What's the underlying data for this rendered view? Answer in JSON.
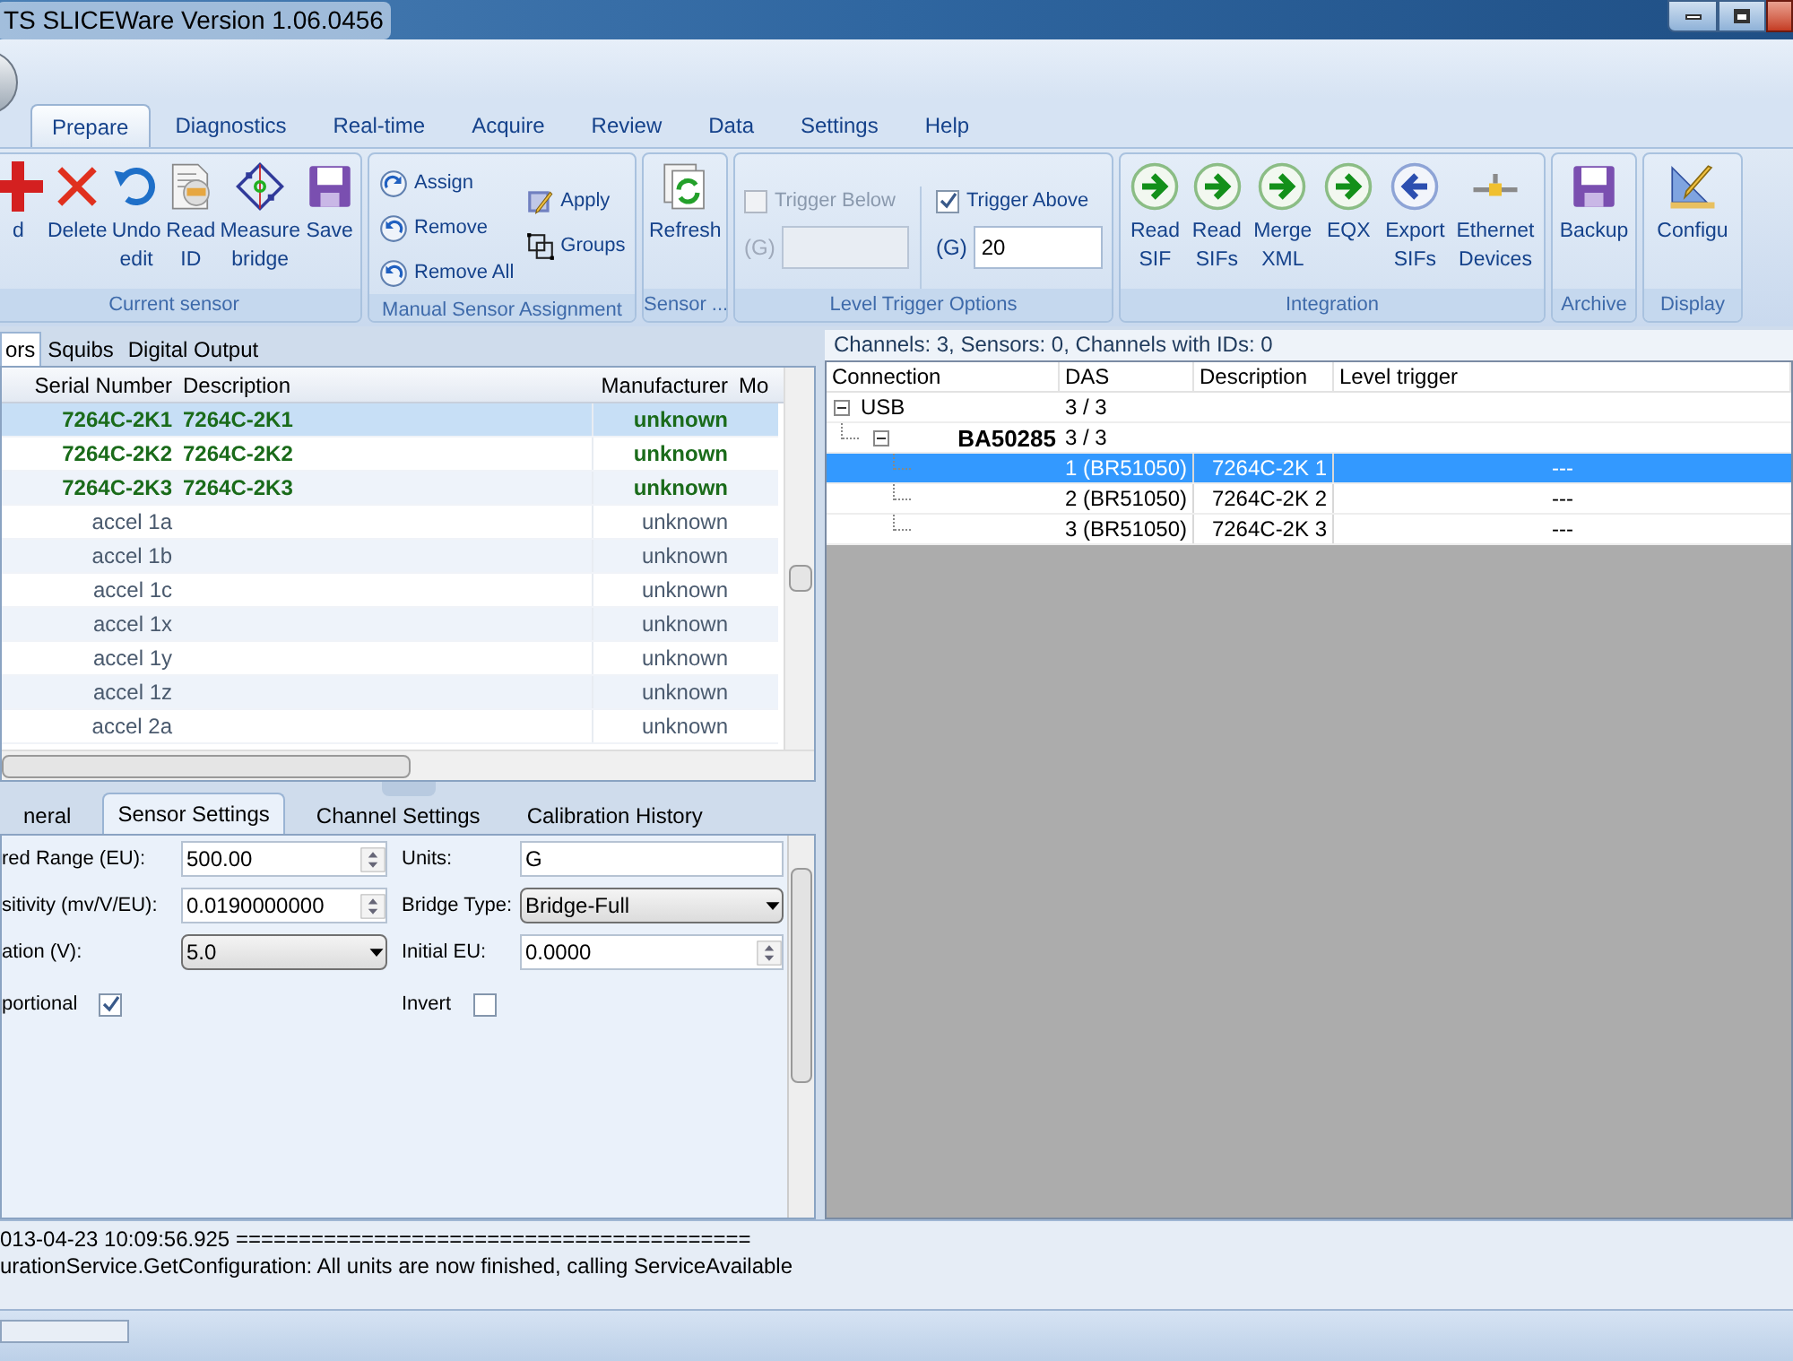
{
  "window": {
    "title": "TS SLICEWare Version 1.06.0456"
  },
  "menu_tabs": [
    {
      "label": "Prepare",
      "selected": true
    },
    {
      "label": "Diagnostics",
      "selected": false
    },
    {
      "label": "Real-time",
      "selected": false
    },
    {
      "label": "Acquire",
      "selected": false
    },
    {
      "label": "Review",
      "selected": false
    },
    {
      "label": "Data",
      "selected": false
    },
    {
      "label": "Settings",
      "selected": false
    },
    {
      "label": "Help",
      "selected": false
    }
  ],
  "ribbon": {
    "groups": [
      {
        "label": "Current sensor",
        "kind": "large",
        "buttons": [
          "d",
          "Delete",
          "Undo\nedit",
          "Read\nID",
          "Measure\nbridge",
          "Save"
        ]
      },
      {
        "label": "Manual Sensor Assignment",
        "kind": "small",
        "buttons": [
          "Assign",
          "Remove",
          "Remove All",
          "Apply",
          "Groups"
        ]
      },
      {
        "label": "Sensor ...",
        "kind": "large",
        "buttons": [
          "Refresh"
        ]
      },
      {
        "label": "Level Trigger Options",
        "kind": "triggers",
        "triggers": [
          {
            "label": "Trigger Below",
            "checked": false,
            "disabled": true,
            "unit": "(G)"
          },
          {
            "label": "Trigger Above",
            "checked": true,
            "disabled": false,
            "unit": "(G)",
            "value": "20"
          }
        ]
      },
      {
        "label": "Integration",
        "kind": "large",
        "buttons": [
          "Read\nSIF",
          "Read\nSIFs",
          "Merge\nXML",
          "EQX",
          "Export\nSIFs",
          "Ethernet\nDevices"
        ]
      },
      {
        "label": "Archive",
        "kind": "large",
        "buttons": [
          "Backup"
        ]
      },
      {
        "label": "Display",
        "kind": "large",
        "buttons": [
          "Configu"
        ]
      }
    ]
  },
  "sensor_tabs": [
    {
      "label": "ors",
      "selected": true
    },
    {
      "label": "Squibs",
      "selected": false
    },
    {
      "label": "Digital Output",
      "selected": false
    }
  ],
  "sensor_table": {
    "columns": [
      "Serial Number",
      "Description",
      "Manufacturer",
      "Mo"
    ],
    "rows": [
      {
        "serial": "7264C-2K1",
        "description": "7264C-2K1",
        "manufacturer": "unknown",
        "assigned": true,
        "selected": true
      },
      {
        "serial": "7264C-2K2",
        "description": "7264C-2K2",
        "manufacturer": "unknown",
        "assigned": true,
        "selected": false
      },
      {
        "serial": "7264C-2K3",
        "description": "7264C-2K3",
        "manufacturer": "unknown",
        "assigned": true,
        "selected": false
      },
      {
        "serial": "accel 1a",
        "manufacturer": "unknown",
        "assigned": false,
        "selected": false
      },
      {
        "serial": "accel 1b",
        "manufacturer": "unknown",
        "assigned": false,
        "selected": false
      },
      {
        "serial": "accel 1c",
        "manufacturer": "unknown",
        "assigned": false,
        "selected": false
      },
      {
        "serial": "accel 1x",
        "manufacturer": "unknown",
        "assigned": false,
        "selected": false
      },
      {
        "serial": "accel 1y",
        "manufacturer": "unknown",
        "assigned": false,
        "selected": false
      },
      {
        "serial": "accel 1z",
        "manufacturer": "unknown",
        "assigned": false,
        "selected": false
      },
      {
        "serial": "accel 2a",
        "manufacturer": "unknown",
        "assigned": false,
        "selected": false
      }
    ]
  },
  "detail_tabs": [
    {
      "label": "neral",
      "selected": false
    },
    {
      "label": "Sensor Settings",
      "selected": true
    },
    {
      "label": "Channel Settings",
      "selected": false
    },
    {
      "label": "Calibration History",
      "selected": false
    }
  ],
  "sensor_settings": {
    "left": [
      {
        "kind": "spin",
        "label": "red Range (EU):",
        "value": "500.00"
      },
      {
        "kind": "spin",
        "label": "sitivity (mv/V/EU):",
        "value": "0.0190000000"
      },
      {
        "kind": "dropdown",
        "label": "ation (V):",
        "value": "5.0"
      },
      {
        "kind": "checkbox",
        "label": "portional",
        "checked": true
      }
    ],
    "right": [
      {
        "kind": "text",
        "label": "Units:",
        "value": "G"
      },
      {
        "kind": "dropdown",
        "label": "Bridge Type:",
        "value": "Bridge-Full"
      },
      {
        "kind": "spin",
        "label": "Initial EU:",
        "value": "0.0000"
      },
      {
        "kind": "checkbox",
        "label": "Invert",
        "checked": false
      }
    ]
  },
  "channels_summary": "Channels: 3, Sensors: 0, Channels with IDs: 0",
  "channel_tree": {
    "columns": [
      "Connection",
      "DAS",
      "Description",
      "Level trigger"
    ],
    "nodes": [
      {
        "label": "USB",
        "das": "3 / 3",
        "expanded": true,
        "selected": false,
        "children": [
          {
            "label": "BA50285",
            "das": "3 / 3",
            "expanded": true,
            "selected": false,
            "children": [
              {
                "das": "1 (BR51050)",
                "description": "7264C-2K 1",
                "level_trigger": "---",
                "selected": true
              },
              {
                "das": "2 (BR51050)",
                "description": "7264C-2K 2",
                "level_trigger": "---",
                "selected": false
              },
              {
                "das": "3 (BR51050)",
                "description": "7264C-2K 3",
                "level_trigger": "---",
                "selected": false
              }
            ]
          }
        ]
      }
    ]
  },
  "log": [
    "013-04-23 10:09:56.925 =========================================",
    "urationService.GetConfiguration: All units are now finished, calling ServiceAvailable"
  ]
}
